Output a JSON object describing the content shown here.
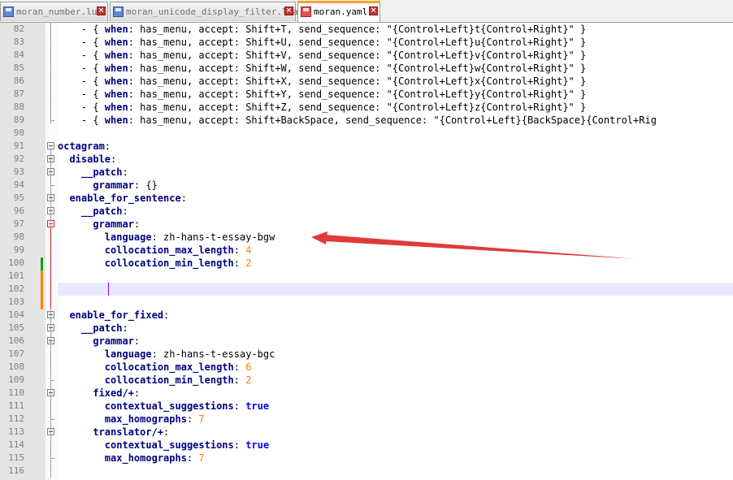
{
  "tabs": [
    {
      "label": "moran_number.lua",
      "active": false
    },
    {
      "label": "moran_unicode_display_filter.lua",
      "active": false
    },
    {
      "label": "moran.yaml",
      "active": true
    }
  ],
  "colors": {
    "accent_tab": "#f8a030",
    "arrow": "#e03a3a",
    "current_line": "#e8e8ff",
    "keyword": "#000080",
    "number": "#ff8000",
    "boolean": "#0000ff"
  },
  "icons": [
    "file-lua-icon",
    "close-tab-icon",
    "file-yaml-icon",
    "fold-minus-icon",
    "red-arrow-annotation"
  ],
  "editor": {
    "current_line": 102,
    "lines": [
      {
        "num": "82",
        "tokens": [
          [
            "p",
            "    - { "
          ],
          [
            "k",
            "when"
          ],
          [
            "p",
            ": has_menu, accept: Shift+T, send_sequence: \"{Control+Left}t{Control+Right}\" }"
          ]
        ]
      },
      {
        "num": "83",
        "tokens": [
          [
            "p",
            "    - { "
          ],
          [
            "k",
            "when"
          ],
          [
            "p",
            ": has_menu, accept: Shift+U, send_sequence: \"{Control+Left}u{Control+Right}\" }"
          ]
        ]
      },
      {
        "num": "84",
        "tokens": [
          [
            "p",
            "    - { "
          ],
          [
            "k",
            "when"
          ],
          [
            "p",
            ": has_menu, accept: Shift+V, send_sequence: \"{Control+Left}v{Control+Right}\" }"
          ]
        ]
      },
      {
        "num": "85",
        "tokens": [
          [
            "p",
            "    - { "
          ],
          [
            "k",
            "when"
          ],
          [
            "p",
            ": has_menu, accept: Shift+W, send_sequence: \"{Control+Left}w{Control+Right}\" }"
          ]
        ]
      },
      {
        "num": "86",
        "tokens": [
          [
            "p",
            "    - { "
          ],
          [
            "k",
            "when"
          ],
          [
            "p",
            ": has_menu, accept: Shift+X, send_sequence: \"{Control+Left}x{Control+Right}\" }"
          ]
        ]
      },
      {
        "num": "87",
        "tokens": [
          [
            "p",
            "    - { "
          ],
          [
            "k",
            "when"
          ],
          [
            "p",
            ": has_menu, accept: Shift+Y, send_sequence: \"{Control+Left}y{Control+Right}\" }"
          ]
        ]
      },
      {
        "num": "88",
        "tokens": [
          [
            "p",
            "    - { "
          ],
          [
            "k",
            "when"
          ],
          [
            "p",
            ": has_menu, accept: Shift+Z, send_sequence: \"{Control+Left}z{Control+Right}\" }"
          ]
        ]
      },
      {
        "num": "89",
        "tokens": [
          [
            "p",
            "    - { "
          ],
          [
            "k",
            "when"
          ],
          [
            "p",
            ": has_menu, accept: Shift+BackSpace, send_sequence: \"{Control+Left}{BackSpace}{Control+Rig"
          ]
        ]
      },
      {
        "num": "90",
        "tokens": []
      },
      {
        "num": "91",
        "tokens": [
          [
            "k",
            "octagram"
          ],
          [
            "p",
            ":"
          ]
        ]
      },
      {
        "num": "92",
        "tokens": [
          [
            "k",
            "  disable"
          ],
          [
            "p",
            ":"
          ]
        ]
      },
      {
        "num": "93",
        "tokens": [
          [
            "k",
            "    __patch"
          ],
          [
            "p",
            ":"
          ]
        ]
      },
      {
        "num": "94",
        "tokens": [
          [
            "k",
            "      grammar"
          ],
          [
            "p",
            ": {}"
          ]
        ]
      },
      {
        "num": "95",
        "tokens": [
          [
            "k",
            "  enable_for_sentence"
          ],
          [
            "p",
            ":"
          ]
        ]
      },
      {
        "num": "96",
        "tokens": [
          [
            "k",
            "    __patch"
          ],
          [
            "p",
            ":"
          ]
        ]
      },
      {
        "num": "97",
        "tokens": [
          [
            "k",
            "      grammar"
          ],
          [
            "p",
            ":"
          ]
        ]
      },
      {
        "num": "98",
        "tokens": [
          [
            "k",
            "        language"
          ],
          [
            "p",
            ": zh-hans-t-essay-bgw"
          ]
        ]
      },
      {
        "num": "99",
        "tokens": [
          [
            "k",
            "        collocation_max_length"
          ],
          [
            "p",
            ": "
          ],
          [
            "n",
            "4"
          ]
        ]
      },
      {
        "num": "100",
        "tokens": [
          [
            "k",
            "        collocation_min_length"
          ],
          [
            "p",
            ": "
          ],
          [
            "n",
            "2"
          ]
        ]
      },
      {
        "num": "101",
        "tokens": []
      },
      {
        "num": "102",
        "tokens": []
      },
      {
        "num": "103",
        "tokens": []
      },
      {
        "num": "104",
        "tokens": [
          [
            "k",
            "  enable_for_fixed"
          ],
          [
            "p",
            ":"
          ]
        ]
      },
      {
        "num": "105",
        "tokens": [
          [
            "k",
            "    __patch"
          ],
          [
            "p",
            ":"
          ]
        ]
      },
      {
        "num": "106",
        "tokens": [
          [
            "k",
            "      grammar"
          ],
          [
            "p",
            ":"
          ]
        ]
      },
      {
        "num": "107",
        "tokens": [
          [
            "k",
            "        language"
          ],
          [
            "p",
            ": zh-hans-t-essay-bgc"
          ]
        ]
      },
      {
        "num": "108",
        "tokens": [
          [
            "k",
            "        collocation_max_length"
          ],
          [
            "p",
            ": "
          ],
          [
            "n",
            "6"
          ]
        ]
      },
      {
        "num": "109",
        "tokens": [
          [
            "k",
            "        collocation_min_length"
          ],
          [
            "p",
            ": "
          ],
          [
            "n",
            "2"
          ]
        ]
      },
      {
        "num": "110",
        "tokens": [
          [
            "k",
            "      fixed/+"
          ],
          [
            "p",
            ":"
          ]
        ]
      },
      {
        "num": "111",
        "tokens": [
          [
            "k",
            "        contextual_suggestions"
          ],
          [
            "p",
            ": "
          ],
          [
            "b",
            "true"
          ]
        ]
      },
      {
        "num": "112",
        "tokens": [
          [
            "k",
            "        max_homographs"
          ],
          [
            "p",
            ": "
          ],
          [
            "n",
            "7"
          ]
        ]
      },
      {
        "num": "113",
        "tokens": [
          [
            "k",
            "      translator/+"
          ],
          [
            "p",
            ":"
          ]
        ]
      },
      {
        "num": "114",
        "tokens": [
          [
            "k",
            "        contextual_suggestions"
          ],
          [
            "p",
            ": "
          ],
          [
            "b",
            "true"
          ]
        ]
      },
      {
        "num": "115",
        "tokens": [
          [
            "k",
            "        max_homographs"
          ],
          [
            "p",
            ": "
          ],
          [
            "n",
            "7"
          ]
        ]
      },
      {
        "num": "116",
        "tokens": []
      }
    ]
  }
}
